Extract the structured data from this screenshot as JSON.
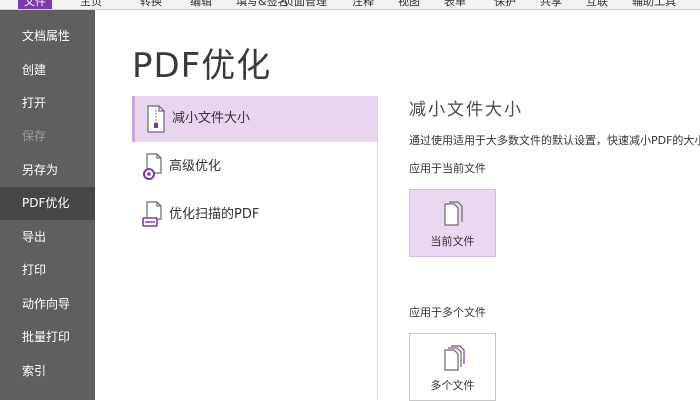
{
  "ribbon": {
    "tabs": [
      {
        "label": "文件",
        "active": true
      },
      {
        "label": "主页"
      },
      {
        "label": "转换"
      },
      {
        "label": "编辑"
      },
      {
        "label": "填写&签名"
      },
      {
        "label": "页面管理"
      },
      {
        "label": "注释"
      },
      {
        "label": "视图"
      },
      {
        "label": "表单"
      },
      {
        "label": "保护"
      },
      {
        "label": "共享"
      },
      {
        "label": "互联"
      },
      {
        "label": "辅助工具"
      }
    ],
    "accent_color": "#7b3aa6"
  },
  "sidebar": {
    "items": [
      {
        "label": "文档属性"
      },
      {
        "label": "创建"
      },
      {
        "label": "打开"
      },
      {
        "label": "保存",
        "disabled": true
      },
      {
        "label": "另存为"
      },
      {
        "label": "PDF优化",
        "selected": true
      },
      {
        "label": "导出"
      },
      {
        "label": "打印"
      },
      {
        "label": "动作向导"
      },
      {
        "label": "批量打印"
      },
      {
        "label": "索引"
      }
    ]
  },
  "main": {
    "title": "PDF优化",
    "options": [
      {
        "label": "减小文件大小",
        "icon": "zip-document-icon",
        "selected": true
      },
      {
        "label": "高级优化",
        "icon": "document-gear-icon"
      },
      {
        "label": "优化扫描的PDF",
        "icon": "document-scanner-icon"
      }
    ]
  },
  "panel": {
    "title": "减小文件大小",
    "description": "通过使用适用于大多数文件的默认设置，快速减小PDF的大小。",
    "current_section_label": "应用于当前文件",
    "current_button_label": "当前文件",
    "multi_section_label": "应用于多个文件",
    "multi_button_label": "多个文件"
  }
}
